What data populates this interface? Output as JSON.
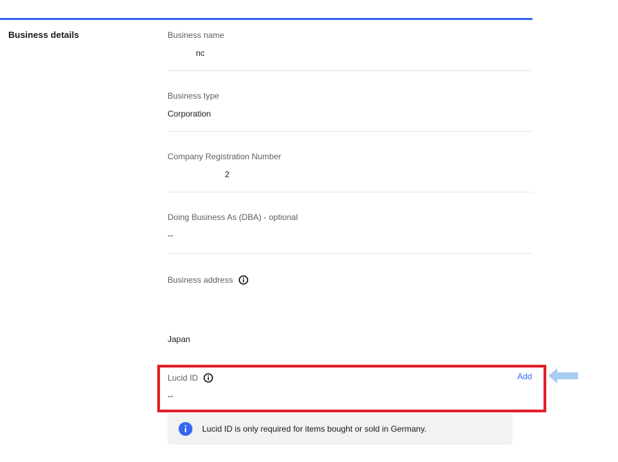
{
  "section_title": "Business details",
  "fields": {
    "business_name": {
      "label": "Business name",
      "value": "nc"
    },
    "business_type": {
      "label": "Business type",
      "value": "Corporation"
    },
    "registration_number": {
      "label": "Company Registration Number",
      "value": "2"
    },
    "dba": {
      "label": "Doing Business As (DBA) - optional",
      "value": "--"
    },
    "business_address": {
      "label": "Business address",
      "value": "Japan",
      "icon": "info-icon"
    },
    "lucid_id": {
      "label": "Lucid ID",
      "value": "--",
      "icon": "info-icon",
      "action_label": "Add"
    }
  },
  "notice": {
    "icon": "info-filled-icon",
    "text": "Lucid ID is only required for items bought or sold in Germany."
  },
  "colors": {
    "accent": "#3665f3",
    "highlight": "#e0202a",
    "callout_arrow": "#a8cdf0",
    "notice_bg": "#f2f2f2"
  }
}
